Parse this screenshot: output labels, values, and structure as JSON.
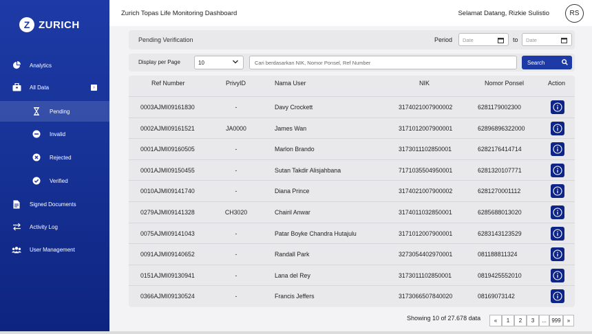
{
  "brand": {
    "logo_letter": "Z",
    "name": "ZURICH"
  },
  "header": {
    "title": "Zurich Topas Life Monitoring Dashboard",
    "greeting": "Selamat Datang, Rizkie Sulistio",
    "avatar_initials": "RS"
  },
  "sidebar": {
    "items": [
      {
        "label": "Analytics",
        "icon": "pie-chart-icon"
      },
      {
        "label": "All Data",
        "icon": "briefcase-icon",
        "expand": "›"
      },
      {
        "label": "Pending",
        "icon": "hourglass-icon"
      },
      {
        "label": "Invalid",
        "icon": "minus-circle-icon"
      },
      {
        "label": "Rejected",
        "icon": "x-circle-icon"
      },
      {
        "label": "Verified",
        "icon": "check-circle-icon"
      },
      {
        "label": "Signed Documents",
        "icon": "document-icon"
      },
      {
        "label": "Activity Log",
        "icon": "swap-arrows-icon"
      },
      {
        "label": "User Management",
        "icon": "users-icon"
      }
    ]
  },
  "filters": {
    "section_title": "Pending Verification",
    "period_label": "Period",
    "to_label": "to",
    "date_placeholder": "Date",
    "display_label": "Display per Page",
    "per_page_value": "10",
    "search_placeholder": "Cari berdasarkan NIK, Nomor Ponsel, Ref Number",
    "search_button": "Search"
  },
  "table": {
    "columns": [
      "Ref Number",
      "PrivyID",
      "Nama User",
      "NIK",
      "Nomor Ponsel",
      "Action"
    ],
    "rows": [
      [
        "0003AJMI09161830",
        "-",
        "Davy Crockett",
        "3174021007900002",
        "6281179002300"
      ],
      [
        "0002AJMI09161521",
        "JA0000",
        "James Wan",
        "3171012007900001",
        "62896896322000"
      ],
      [
        "0001AJMI09160505",
        "-",
        "Marlon Brando",
        "3173011102850001",
        "6282176414714"
      ],
      [
        "0001AJMI09150455",
        "-",
        "Sutan Takdir Alisjahbana",
        "7171035504950001",
        "6281320107771"
      ],
      [
        "0010AJMI09141740",
        "-",
        "Diana Prince",
        "3174021007900002",
        "6281270001112"
      ],
      [
        "0279AJMI09141328",
        "CH3020",
        "Chairil Anwar",
        "3174011032850001",
        "6285688013020"
      ],
      [
        "0075AJMI09141043",
        "-",
        "Patar Boyke Chandra Hutajulu",
        "3171012007900001",
        "6283143123529"
      ],
      [
        "0091AJMI09140652",
        "-",
        "Randall Park",
        "3273054402970001",
        "081188811324"
      ],
      [
        "0151AJMI09130941",
        "-",
        "Lana del Rey",
        "3173011102850001",
        "0819425552010"
      ],
      [
        "0366AJMI09130524",
        "-",
        "Francis Jeffers",
        "3173066507840020",
        "08169073142"
      ]
    ]
  },
  "pagination": {
    "summary": "Showing 10 of 27.678 data",
    "prev": "«",
    "pages": [
      "1",
      "2",
      "3",
      "...",
      "999"
    ],
    "next": "»"
  },
  "colors": {
    "primary": "#1d3aa6",
    "action": "#0f2487"
  }
}
